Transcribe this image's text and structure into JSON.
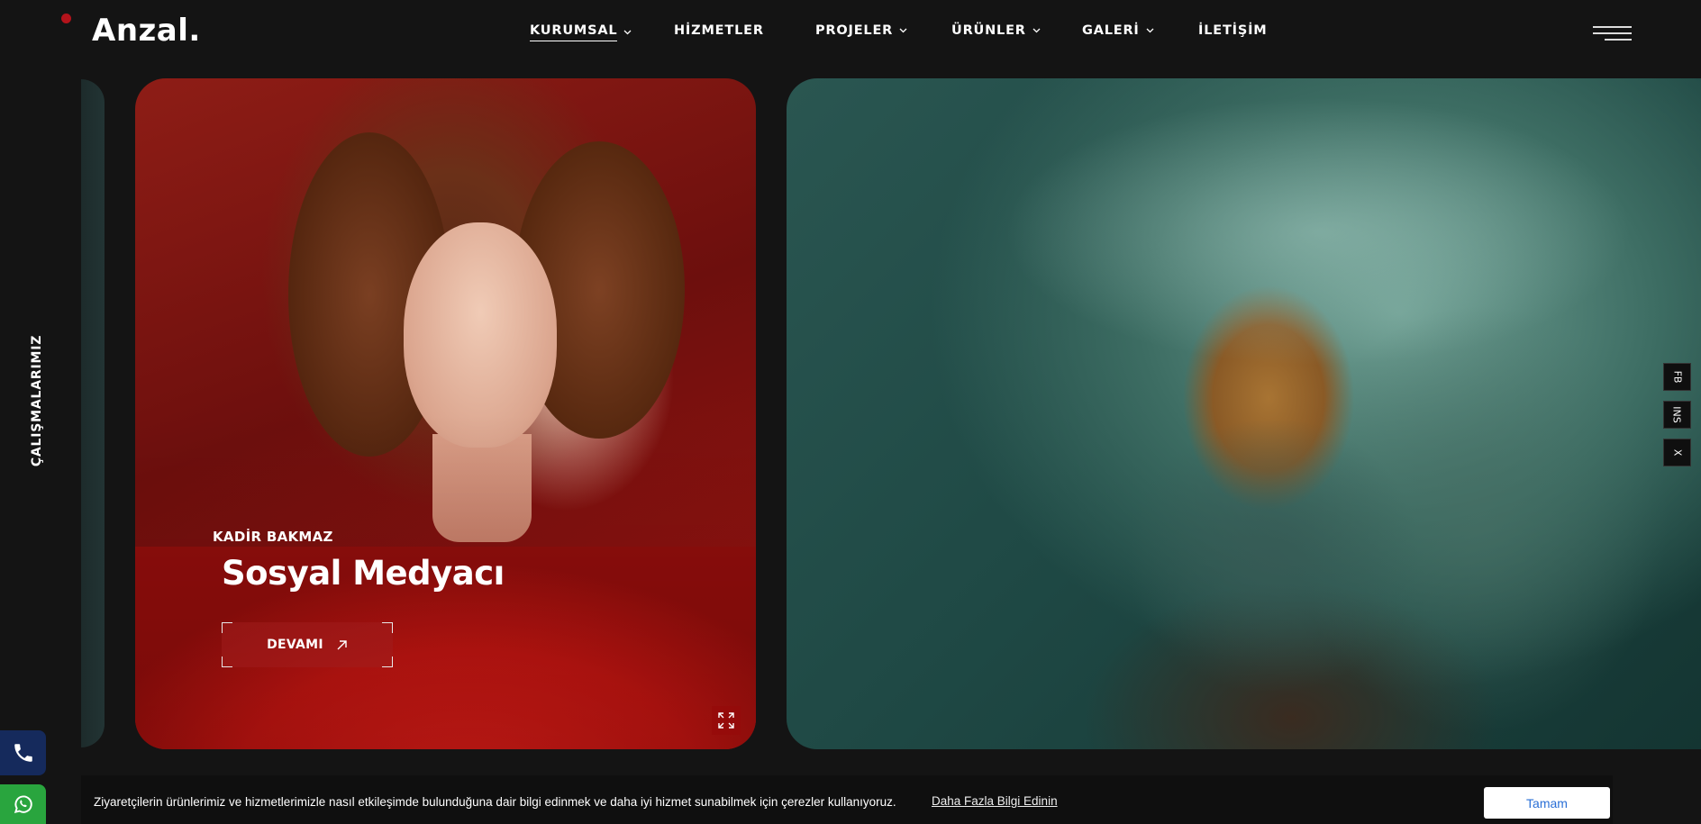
{
  "brand": {
    "logo": "Anzal.",
    "accent_color": "#b3131b"
  },
  "nav": {
    "items": [
      {
        "label": "KURUMSAL",
        "has_dropdown": true,
        "active": true
      },
      {
        "label": "HİZMETLER",
        "has_dropdown": false
      },
      {
        "label": "PROJELER",
        "has_dropdown": true
      },
      {
        "label": "ÜRÜNLER",
        "has_dropdown": true
      },
      {
        "label": "GALERİ",
        "has_dropdown": true
      },
      {
        "label": "İLETİŞİM",
        "has_dropdown": false
      }
    ]
  },
  "section_label": "ÇALIŞMALARIMIZ",
  "slides": [
    {
      "name": "KADİR BAKMAZ",
      "title": "Sosyal Medyacı",
      "button_label": "DEVAMI"
    }
  ],
  "social": [
    "FB",
    "INS",
    "X"
  ],
  "contact": {
    "phone_color": "#152a5c",
    "whatsapp_color": "#29a53e"
  },
  "cookie": {
    "text": "Ziyaretçilerin ürünlerimiz ve hizmetlerimizle nasıl etkileşimde bulunduğuna dair bilgi edinmek ve daha iyi hizmet sunabilmek için çerezler kullanıyoruz.",
    "link": "Daha Fazla Bilgi Edinin",
    "button": "Tamam"
  }
}
